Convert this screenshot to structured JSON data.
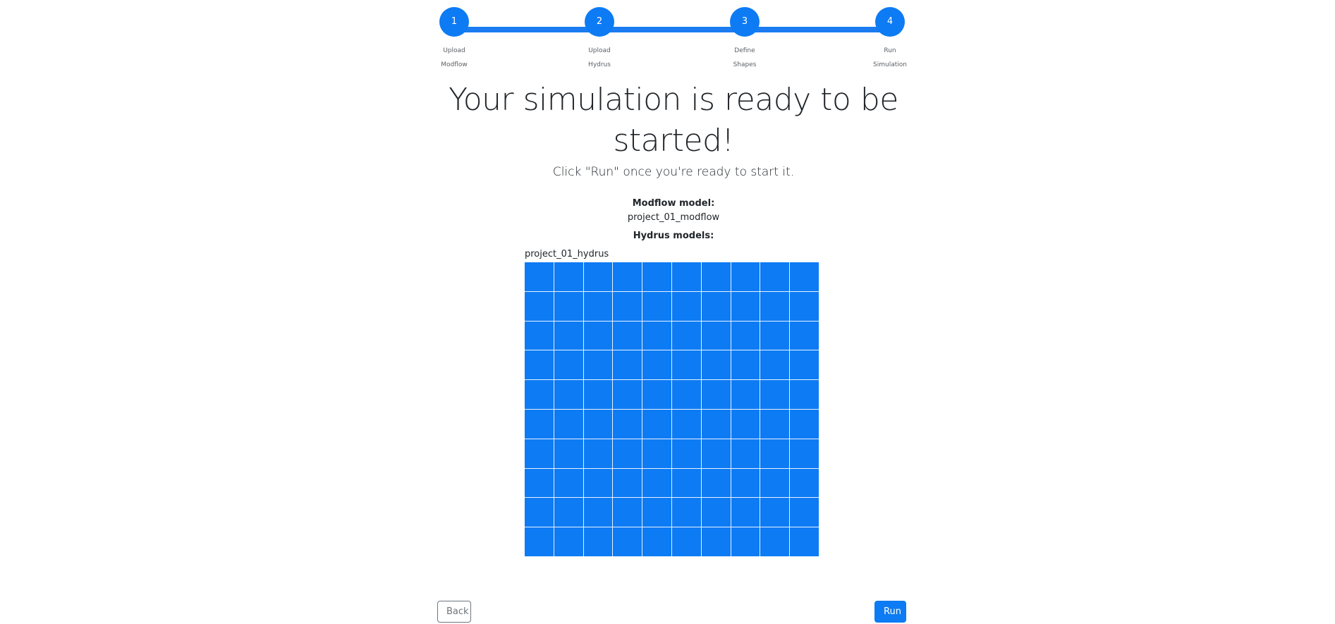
{
  "stepper": {
    "steps": [
      {
        "number": "1",
        "label_line1": "Upload",
        "label_line2": "Modflow"
      },
      {
        "number": "2",
        "label_line1": "Upload",
        "label_line2": "Hydrus"
      },
      {
        "number": "3",
        "label_line1": "Define",
        "label_line2": "Shapes"
      },
      {
        "number": "4",
        "label_line1": "Run",
        "label_line2": "Simulation"
      }
    ],
    "active_step": 4
  },
  "main": {
    "title": "Your simulation is ready to be started!",
    "subtitle": "Click \"Run\" once you're ready to start it.",
    "modflow_label": "Modflow model:",
    "modflow_value": "project_01_modflow",
    "hydrus_label": "Hydrus models:",
    "hydrus_model_name": "project_01_hydrus"
  },
  "grid": {
    "rows": 10,
    "cols": 10,
    "cell_color": "#0d7bf3"
  },
  "footer": {
    "back_label": "Back",
    "run_label": "Run"
  },
  "colors": {
    "accent": "#0d7bf3"
  }
}
